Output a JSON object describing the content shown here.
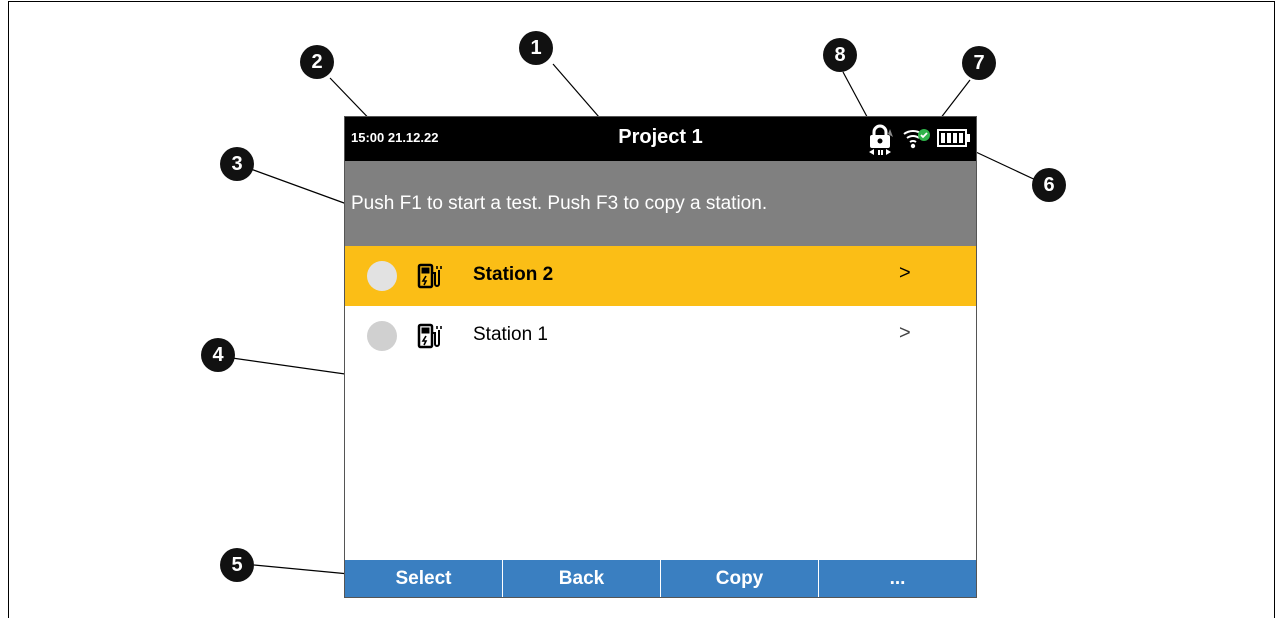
{
  "statusbar": {
    "time": "15:00 21.12.22",
    "title": "Project 1",
    "icons": [
      "lock-icon",
      "wifi-connected-icon",
      "battery-icon"
    ]
  },
  "hint": "Push F1 to start a test.  Push F3 to copy a station.",
  "stations": [
    {
      "label": "Station 2",
      "selected": true,
      "icon": "ev-charger-icon",
      "status": "circle-grey"
    },
    {
      "label": "Station 1",
      "selected": false,
      "icon": "ev-charger-icon",
      "status": "circle-grey"
    }
  ],
  "softkeys": [
    "Select",
    "Back",
    "Copy",
    "..."
  ],
  "callouts": [
    "1",
    "2",
    "3",
    "4",
    "5",
    "6",
    "7",
    "8"
  ],
  "colors": {
    "statusbar": "#000000",
    "hint_bg": "#808080",
    "selected_row": "#fbbe16",
    "softkey_bg": "#3a7fc1"
  }
}
